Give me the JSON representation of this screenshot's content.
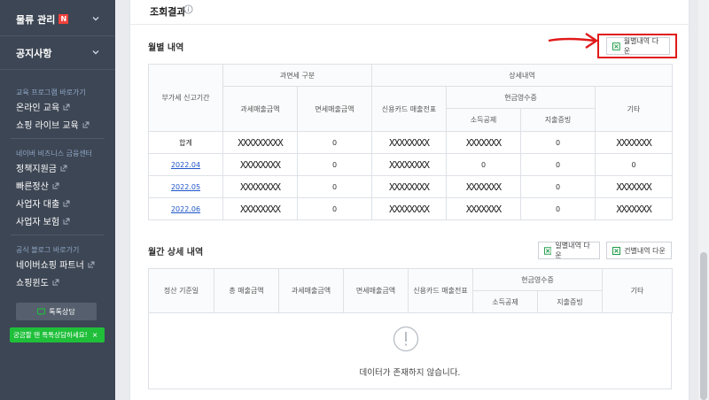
{
  "sidebar": {
    "sections": [
      {
        "label": "물류 관리",
        "badge": "N"
      },
      {
        "label": "공지사항"
      }
    ],
    "groups": [
      {
        "title": "교육 프로그램 바로가기",
        "links": [
          "온라인 교육",
          "쇼핑 라이브 교육"
        ]
      },
      {
        "title": "네이버 비즈니스 금융센터",
        "links": [
          "정책지원금",
          "빠른정산",
          "사업자 대출",
          "사업자 보험"
        ]
      },
      {
        "title": "공식 블로그 바로가기",
        "links": [
          "네이버쇼핑 파트너",
          "쇼핑윈도"
        ]
      }
    ],
    "talk_button": "톡톡상담",
    "talk_tooltip": "궁금할 땐 톡톡상담하세요!",
    "talk_tooltip_close": "×"
  },
  "main": {
    "result_title": "조회결과",
    "monthly": {
      "title": "월별 내역",
      "download_label": "월별내역 다운",
      "headers": {
        "period": "부가세 신고기간",
        "tax_group": "과면세 구분",
        "taxable": "과세매출금액",
        "exempt": "면세매출금액",
        "detail_group": "상세내역",
        "card": "신용카드 매출전표",
        "cash_group": "현금영수증",
        "income": "소득공제",
        "expense": "지출증빙",
        "etc": "기타"
      },
      "rows": [
        {
          "period": "합계",
          "taxable": "XXXXXXXXX",
          "exempt": "0",
          "card": "XXXXXXXX",
          "income": "XXXXXXX",
          "expense": "0",
          "etc": "XXXXXXX",
          "link": false
        },
        {
          "period": "2022.04",
          "taxable": "XXXXXXXX",
          "exempt": "0",
          "card": "XXXXXXXX",
          "income": "0",
          "expense": "0",
          "etc": "0",
          "link": true
        },
        {
          "period": "2022.05",
          "taxable": "XXXXXXXX",
          "exempt": "0",
          "card": "XXXXXXXX",
          "income": "XXXXXXX",
          "expense": "0",
          "etc": "XXXXXXX",
          "link": true
        },
        {
          "period": "2022.06",
          "taxable": "XXXXXXXX",
          "exempt": "0",
          "card": "XXXXXXXX",
          "income": "XXXXXXX",
          "expense": "0",
          "etc": "XXXXXXX",
          "link": true
        }
      ]
    },
    "period_detail": {
      "title": "월간 상세 내역",
      "daily_download": "일별내역 다운",
      "case_download": "건별내역 다운",
      "headers": {
        "date": "정산 기준일",
        "total": "총 매출금액",
        "taxable": "과세매출금액",
        "exempt": "면세매출금액",
        "card": "신용카드 매출전표",
        "cash_group": "현금영수증",
        "income": "소득공제",
        "expense": "지출증빙",
        "etc": "기타"
      },
      "empty_message": "데이터가 존재하지 않습니다."
    }
  },
  "icons": {
    "excel": "excel-icon",
    "info": "info-icon",
    "external": "external-link-icon",
    "chat": "chat-icon",
    "warning": "exclamation-icon"
  },
  "colors": {
    "sidebar_bg": "#3d4654",
    "talk_green": "#1fbf3a",
    "highlight_red": "#e01a1a",
    "link_blue": "#1e56c8"
  }
}
